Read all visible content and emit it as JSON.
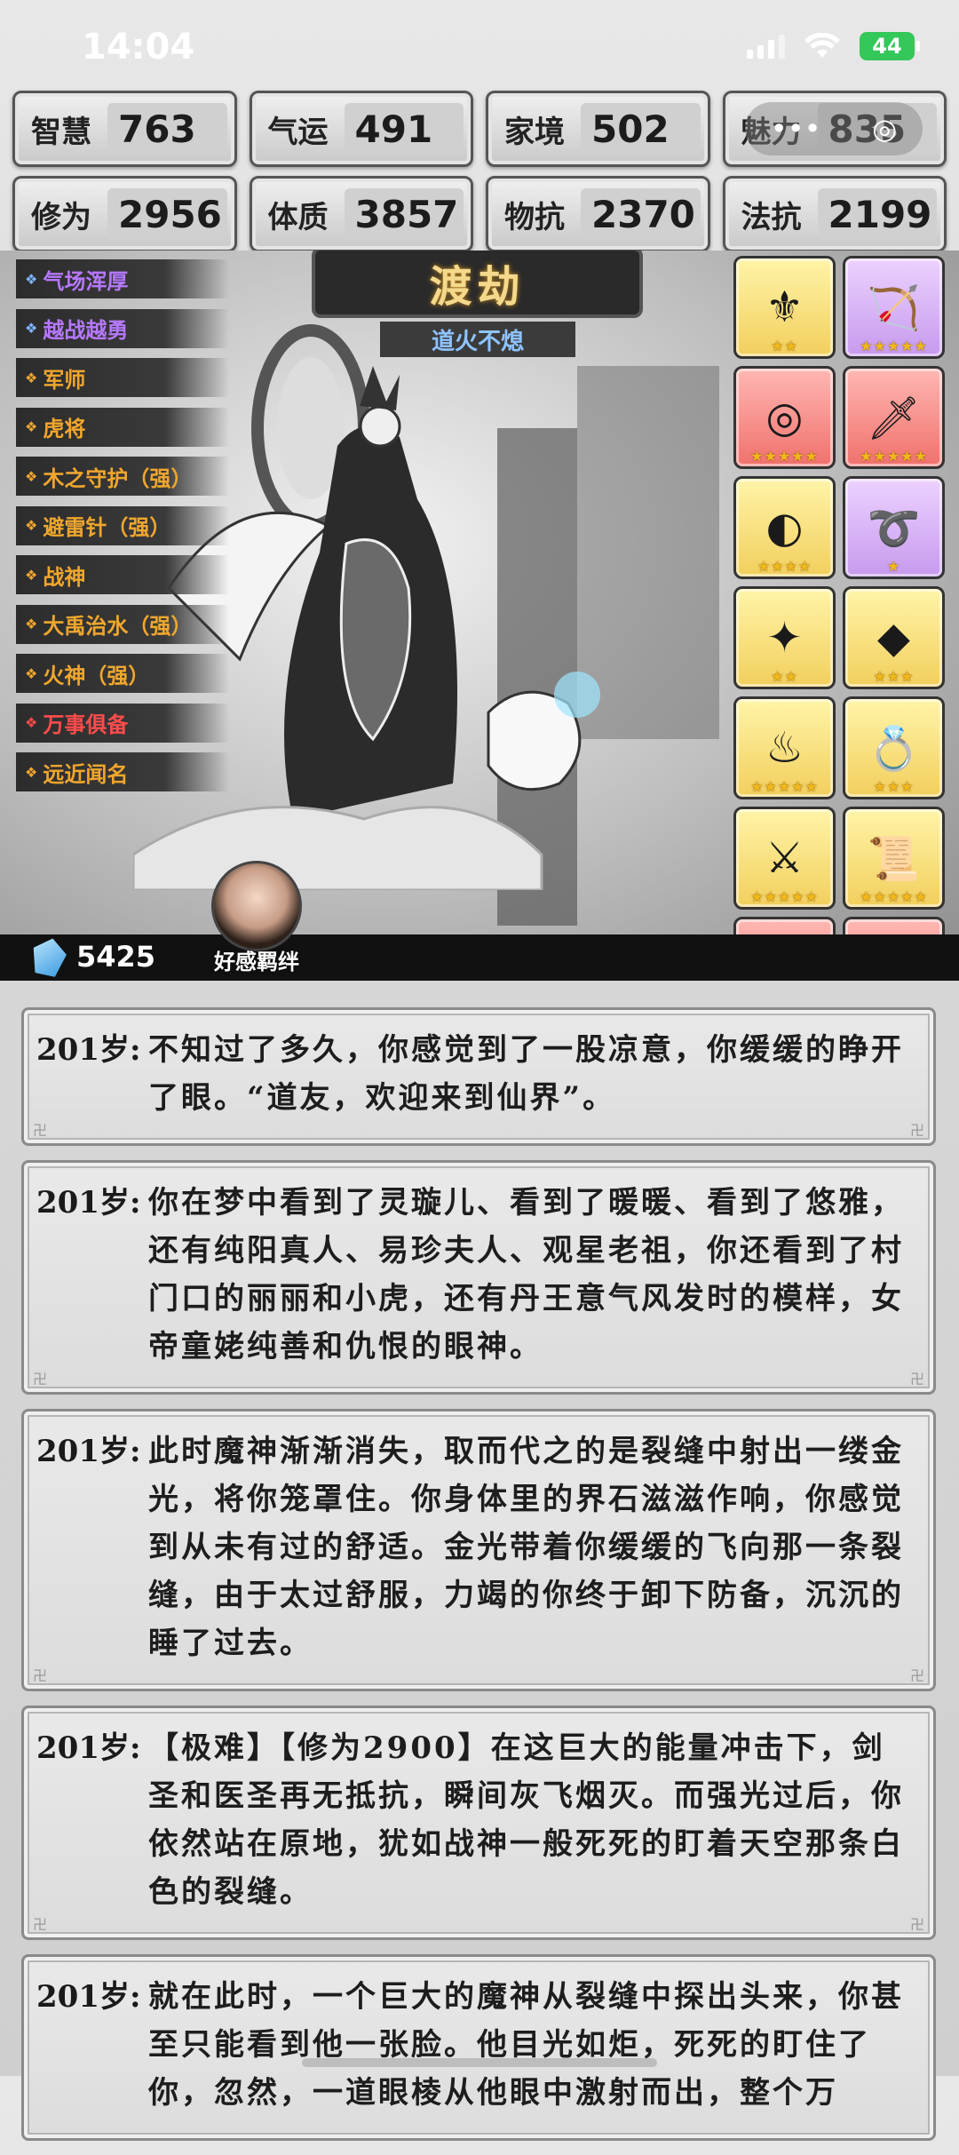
{
  "status_bar": {
    "time": "14:04",
    "battery": "44"
  },
  "stats": [
    {
      "label": "智慧",
      "value": "763"
    },
    {
      "label": "气运",
      "value": "491"
    },
    {
      "label": "家境",
      "value": "502"
    },
    {
      "label": "魅力",
      "value": "835"
    },
    {
      "label": "修为",
      "value": "2956"
    },
    {
      "label": "体质",
      "value": "3857"
    },
    {
      "label": "物抗",
      "value": "2370"
    },
    {
      "label": "法抗",
      "value": "2199"
    }
  ],
  "float_menu": {
    "more": "•••",
    "close": "◎"
  },
  "traits": [
    {
      "label": "气场浑厚",
      "color": "#b678ff"
    },
    {
      "label": "越战越勇",
      "color": "#b678ff"
    },
    {
      "label": "军师",
      "color": "#f0a62d"
    },
    {
      "label": "虎将",
      "color": "#f0a62d"
    },
    {
      "label": "木之守护（强）",
      "color": "#f0a62d"
    },
    {
      "label": "避雷针（强）",
      "color": "#f0a62d"
    },
    {
      "label": "战神",
      "color": "#f0a62d"
    },
    {
      "label": "大禹治水（强）",
      "color": "#f0a62d"
    },
    {
      "label": "火神（强）",
      "color": "#f0a62d"
    },
    {
      "label": "万事俱备",
      "color": "#ff4b4b"
    },
    {
      "label": "远近闻名",
      "color": "#f0a62d"
    }
  ],
  "banner": {
    "title": "渡劫",
    "subtitle": "道火不熄"
  },
  "items": [
    {
      "icon": "golden-scepter-icon",
      "glyph": "⚜",
      "bg": "yellow",
      "stars": "★★"
    },
    {
      "icon": "crossbow-icon",
      "glyph": "🏹",
      "bg": "purple",
      "stars": "★★★★★"
    },
    {
      "icon": "mirror-icon",
      "glyph": "◎",
      "bg": "red",
      "stars": "★★★★★"
    },
    {
      "icon": "sword-icon",
      "glyph": "🗡",
      "bg": "red",
      "stars": "★★★★★"
    },
    {
      "icon": "bracelet-icon",
      "glyph": "◐",
      "bg": "yellow",
      "stars": "★★★★"
    },
    {
      "icon": "ring-dragon-icon",
      "glyph": "➰",
      "bg": "purple",
      "stars": "★"
    },
    {
      "icon": "fan-icon",
      "glyph": "✦",
      "bg": "yellow",
      "stars": "★★"
    },
    {
      "icon": "crystal-icon",
      "glyph": "◆",
      "bg": "yellow",
      "stars": "★★★"
    },
    {
      "icon": "incense-burner-icon",
      "glyph": "♨",
      "bg": "yellow",
      "stars": "★★★★★"
    },
    {
      "icon": "gold-ring-icon",
      "glyph": "💍",
      "bg": "yellow",
      "stars": "★★★"
    },
    {
      "icon": "blade-icon",
      "glyph": "⚔",
      "bg": "yellow",
      "stars": "★★★★★"
    },
    {
      "icon": "scroll-icon",
      "glyph": "📜",
      "bg": "yellow",
      "stars": "★★★★★"
    },
    {
      "icon": "spear-icon",
      "glyph": "⤢",
      "bg": "red",
      "stars": "★★★★★"
    },
    {
      "icon": "halberd-icon",
      "glyph": "⚒",
      "bg": "red",
      "stars": "★★★★★"
    }
  ],
  "currency": {
    "gems": "5425"
  },
  "bond": {
    "label": "好感羁绊"
  },
  "log": [
    {
      "age": "201岁:",
      "text": "不知过了多久，你感觉到了一股凉意，你缓缓的睁开了眼。“道友，欢迎来到仙界”。"
    },
    {
      "age": "201岁:",
      "text": "你在梦中看到了灵璇儿、看到了暖暖、看到了悠雅，还有纯阳真人、易珍夫人、观星老祖，你还看到了村门口的丽丽和小虎，还有丹王意气风发时的模样，女帝童姥纯善和仇恨的眼神。"
    },
    {
      "age": "201岁:",
      "text": "此时魔神渐渐消失，取而代之的是裂缝中射出一缕金光，将你笼罩住。你身体里的界石滋滋作响，你感觉到从未有过的舒适。金光带着你缓缓的飞向那一条裂缝，由于太过舒服，力竭的你终于卸下防备，沉沉的睡了过去。"
    },
    {
      "age": "201岁:",
      "text": "【极难】【修为2900】在这巨大的能量冲击下，剑圣和医圣再无抵抗，瞬间灰飞烟灭。而强光过后，你依然站在原地，犹如战神一般死死的盯着天空那条白色的裂缝。"
    },
    {
      "age": "201岁:",
      "text": "就在此时，一个巨大的魔神从裂缝中探出头来，你甚至只能看到他一张脸。他目光如炬，死死的盯住了你，忽然，一道眼棱从他眼中激射而出，整个万"
    }
  ]
}
